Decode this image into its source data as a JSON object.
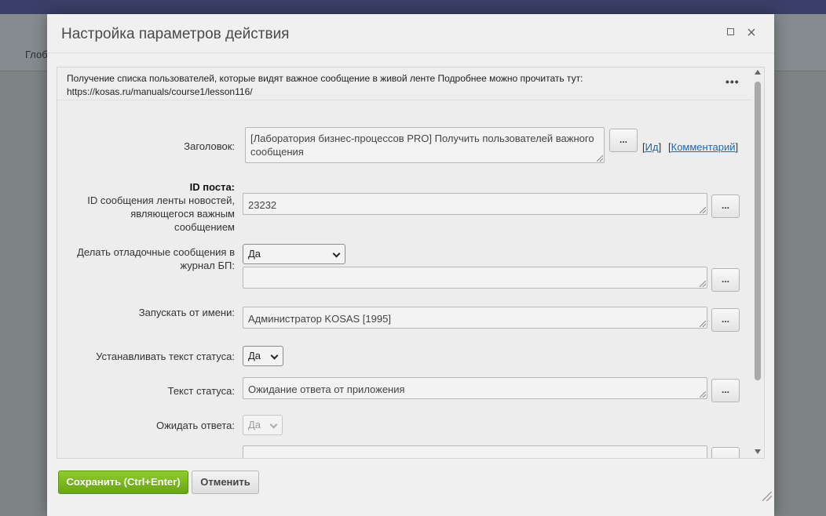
{
  "background": {
    "nav_text": "Глоб"
  },
  "dialog": {
    "title": "Настройка параметров действия",
    "description_line1": "Получение списка пользователей, которые видят важное сообщение в живой ленте Подробнее можно прочитать тут:",
    "description_line2": "https://kosas.ru/manuals/course1/lesson116/",
    "more_glyph": "•••"
  },
  "form": {
    "title_label": "Заголовок:",
    "title_value_line1": "[Лаборатория бизнес-процессов PRO] Получить пользователей важного",
    "title_value_line2": "сообщения",
    "id_link": "Ид",
    "comment_link": "Комментарий",
    "post_id_label": "ID поста:",
    "post_id_desc_1": "ID сообщения ленты новостей,",
    "post_id_desc_2": "являющегося важным",
    "post_id_desc_3": "сообщением",
    "post_id_value": "23232",
    "debug_label_1": "Делать отладочные сообщения в",
    "debug_label_2": "журнал БП:",
    "debug_value": "Да",
    "run_as_label": "Запускать от имени:",
    "run_as_value": "Администратор KOSAS [1995]",
    "set_status_label": "Устанавливать текст статуса:",
    "set_status_value": "Да",
    "status_text_label": "Текст статуса:",
    "status_text_value": "Ожидание ответа от приложения",
    "wait_label": "Ожидать ответа:",
    "wait_value": "Да",
    "ellipsis": "..."
  },
  "buttons": {
    "save": "Сохранить (Ctrl+Enter)",
    "cancel": "Отменить"
  }
}
